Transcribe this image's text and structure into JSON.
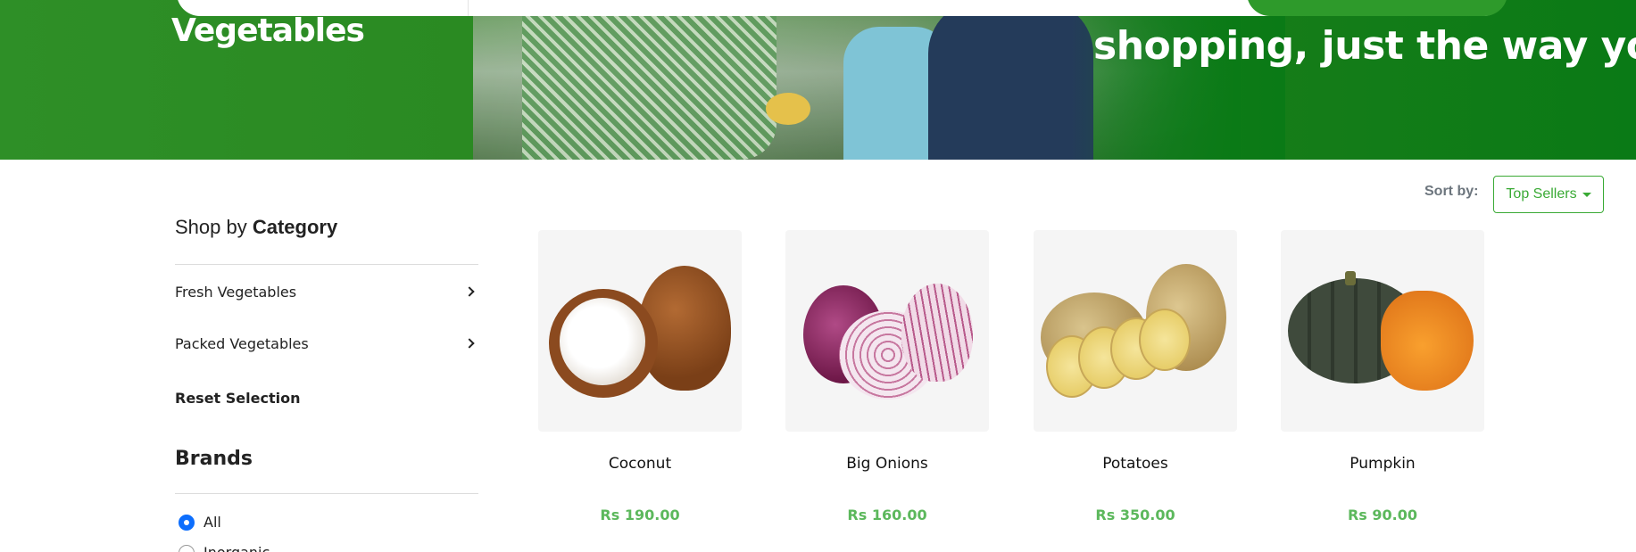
{
  "hero": {
    "title": "Vegetables",
    "slogan": "shopping, just the way you lik"
  },
  "sort": {
    "label": "Sort by:",
    "selected": "Top Sellers"
  },
  "sidebar": {
    "category_heading_prefix": "Shop by ",
    "category_heading_bold": "Category",
    "categories": [
      {
        "label": "Fresh Vegetables"
      },
      {
        "label": "Packed Vegetables"
      }
    ],
    "reset_label": "Reset Selection",
    "brands_heading": "Brands",
    "brands": [
      {
        "label": "All",
        "checked": true
      },
      {
        "label": "Inorganic",
        "checked": false
      }
    ]
  },
  "products": [
    {
      "name": "Coconut",
      "price": "Rs 190.00",
      "icon": "coconut-image"
    },
    {
      "name": "Big Onions",
      "price": "Rs 160.00",
      "icon": "onion-image"
    },
    {
      "name": "Potatoes",
      "price": "Rs 350.00",
      "icon": "potato-image"
    },
    {
      "name": "Pumpkin",
      "price": "Rs 90.00",
      "icon": "pumpkin-image"
    }
  ],
  "colors": {
    "brand_green": "#2e9a2b",
    "price_green": "#5cb85c",
    "radio_blue": "#0d6efd"
  }
}
